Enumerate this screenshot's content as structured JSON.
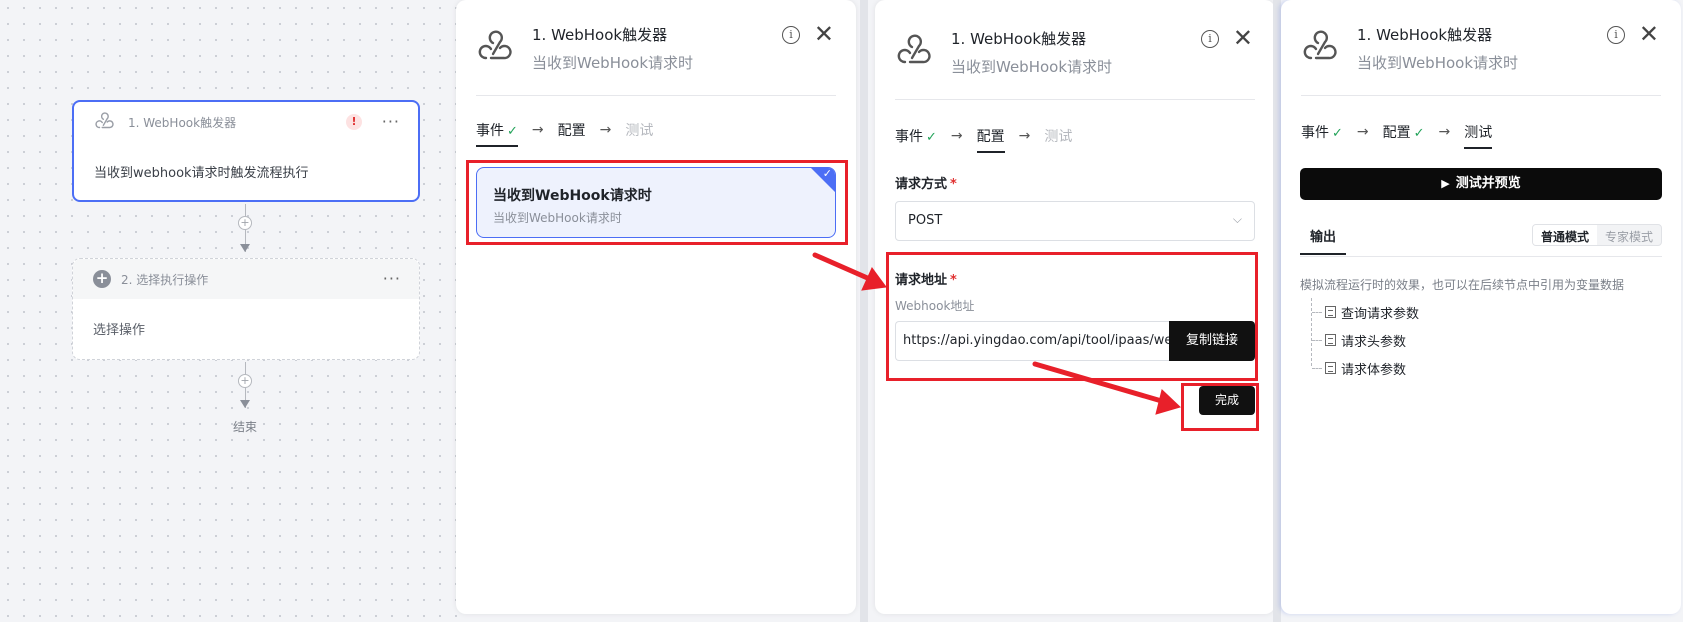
{
  "canvas": {
    "node1": {
      "title": "1. WebHook触发器",
      "warn": "!",
      "more": "···",
      "body": "当收到webhook请求时触发流程执行"
    },
    "node2": {
      "title": "2. 选择执行操作",
      "more": "···",
      "body": "选择操作",
      "plus": "+"
    },
    "add_symbol": "+",
    "end_label": "结束"
  },
  "header": {
    "title": "1. WebHook触发器",
    "subtitle": "当收到WebHook请求时",
    "info": "i",
    "close": "✕"
  },
  "steps": {
    "event": "事件",
    "config": "配置",
    "test": "测试",
    "check": "✓",
    "arrow": "→"
  },
  "panel1": {
    "event_card": {
      "title": "当收到WebHook请求时",
      "subtitle": "当收到WebHook请求时",
      "check": "✓"
    }
  },
  "panel2": {
    "method_label": "请求方式",
    "required_mark": "*",
    "method_value": "POST",
    "chevron": "⌵",
    "url_label": "请求地址",
    "url_hint": "Webhook地址",
    "url_value": "https://api.yingdao.com/api/tool/ipaas/webhook",
    "copy_label": "复制链接",
    "done_label": "完成"
  },
  "panel3": {
    "test_button": "测试并预览",
    "play": "▶",
    "output_tab": "输出",
    "mode_normal": "普通模式",
    "mode_expert": "专家模式",
    "description": "模拟流程运行时的效果，也可以在后续节点中引用为变量数据",
    "tree": [
      "查询请求参数",
      "请求头参数",
      "请求体参数"
    ]
  },
  "colors": {
    "accent": "#4c6ef5",
    "annotation_red": "#e8202a",
    "success": "#23a35a",
    "primary_button": "#111111"
  }
}
